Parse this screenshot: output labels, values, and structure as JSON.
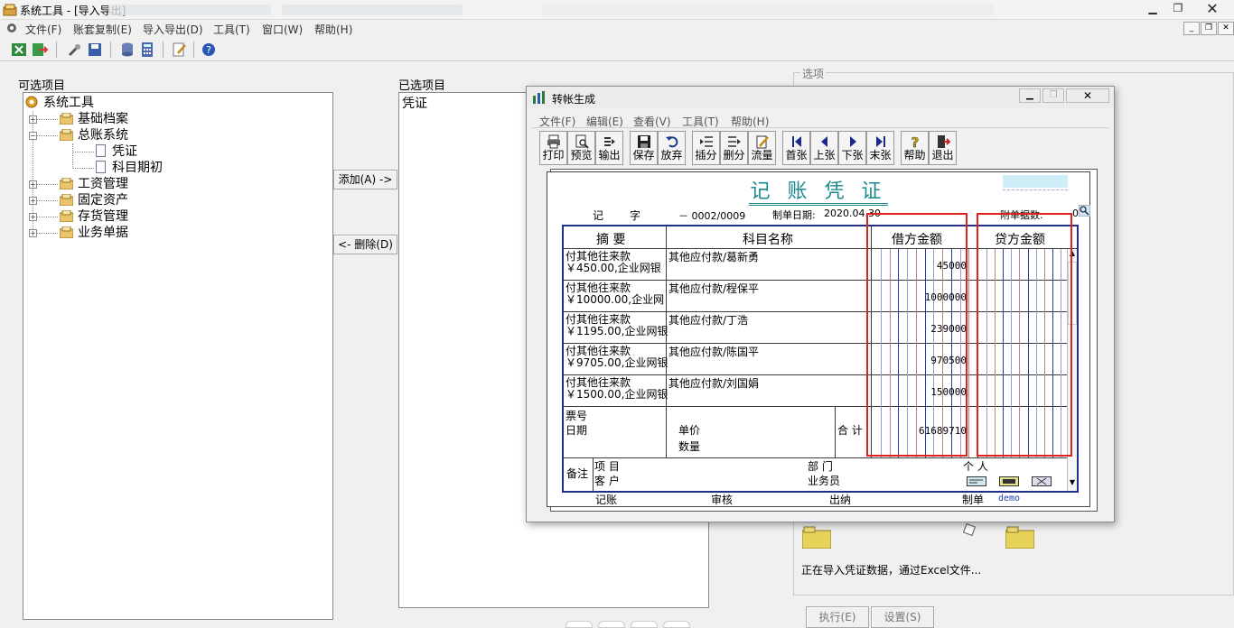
{
  "window": {
    "title": "系统工具 - [导入导出]"
  },
  "menu": [
    "文件(F)",
    "账套复制(E)",
    "导入导出(D)",
    "工具(T)",
    "窗口(W)",
    "帮助(H)"
  ],
  "left": {
    "label": "可选项目",
    "tree": {
      "root": "系统工具",
      "items": [
        "基础档案",
        "总账系统",
        "凭证",
        "科目期初",
        "工资管理",
        "固定资产",
        "存货管理",
        "业务单据"
      ]
    }
  },
  "buttons": {
    "add": "添加(A) ->",
    "remove": "<- 删除(D)",
    "execute": "执行(E)",
    "settings": "设置(S)"
  },
  "right": {
    "label": "已选项目",
    "items": [
      "凭证"
    ]
  },
  "options": {
    "label": "选项",
    "status": "正在导入凭证数据，通过Excel文件..."
  },
  "dialog": {
    "title": "转帐生成",
    "menu": [
      "文件(F)",
      "编辑(E)",
      "查看(V)",
      "工具(T)",
      "帮助(H)"
    ],
    "toolbar": [
      "打印",
      "预览",
      "输出",
      "保存",
      "放弃",
      "插分",
      "删分",
      "流量",
      "首张",
      "上张",
      "下张",
      "末张",
      "帮助",
      "退出"
    ],
    "voucher": {
      "title": "记 账 凭 证",
      "type_label": "记",
      "type_unit": "字",
      "number": "－ 0002/0009",
      "date_label": "制单日期:",
      "date": "2020.04.30",
      "attach_label": "附单据数:",
      "attach_count": "0",
      "col_summary": "摘 要",
      "col_account": "科目名称",
      "col_debit": "借方金额",
      "col_credit": "贷方金额",
      "rows": [
        {
          "summary1": "付其他往来款",
          "summary2": "￥450.00,企业网银",
          "account": "其他应付款/葛新勇",
          "debit": "45000"
        },
        {
          "summary1": "付其他往来款",
          "summary2": "￥10000.00,企业网",
          "account": "其他应付款/程保平",
          "debit": "1000000"
        },
        {
          "summary1": "付其他往来款",
          "summary2": "￥1195.00,企业网银",
          "account": "其他应付款/丁浩",
          "debit": "239000"
        },
        {
          "summary1": "付其他往来款",
          "summary2": "￥9705.00,企业网银",
          "account": "其他应付款/陈国平",
          "debit": "970500"
        },
        {
          "summary1": "付其他往来款",
          "summary2": "￥1500.00,企业网银",
          "account": "其他应付款/刘国娟",
          "debit": "150000"
        }
      ],
      "ticket_label": "票号",
      "date_row_label": "日期",
      "price_label": "单价",
      "qty_label": "数量",
      "total_label": "合 计",
      "total": "61689710",
      "remark_label": "备注",
      "project_label": "项  目",
      "customer_label": "客  户",
      "dept_label": "部  门",
      "salesman_label": "业务员",
      "person_label": "个  人",
      "footer": {
        "post": "记账",
        "audit": "审核",
        "cashier": "出纳",
        "maker_label": "制单",
        "maker": "demo"
      }
    }
  }
}
